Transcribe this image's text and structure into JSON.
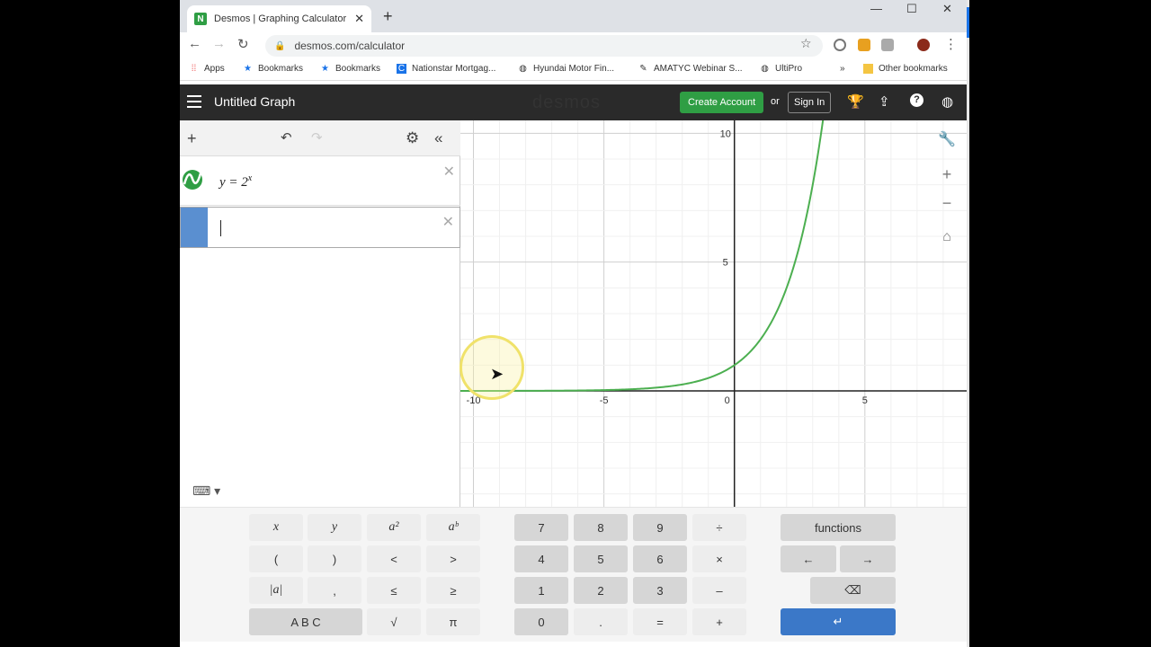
{
  "browser": {
    "tab_title": "Desmos | Graphing Calculator",
    "url": "desmos.com/calculator",
    "bookmarks": [
      "Apps",
      "Bookmarks",
      "Bookmarks",
      "Nationstar Mortgag...",
      "Hyundai Motor Fin...",
      "AMATYC Webinar S...",
      "UltiPro",
      "»",
      "Other bookmarks"
    ]
  },
  "header": {
    "title": "Untitled Graph",
    "logo": "desmos",
    "create_account": "Create Account",
    "or": "or",
    "sign_in": "Sign In"
  },
  "expressions": [
    {
      "latex_display": "y = 2",
      "superscript": "x",
      "color": "#2f9e44"
    },
    {
      "latex_display": "",
      "active": true
    }
  ],
  "graph": {
    "x_ticks": [
      "-10",
      "-5",
      "0",
      "5"
    ],
    "y_ticks": [
      "10",
      "5"
    ],
    "curve_color": "#4caf50",
    "function": "y = 2^x",
    "xlim": [
      -10.5,
      8.9
    ],
    "ylim": [
      -4.5,
      10.5
    ]
  },
  "keypad": {
    "left": [
      "x",
      "y",
      "a²",
      "aᵇ",
      "(",
      ")",
      "<",
      ">",
      "|a|",
      ",",
      "≤",
      "≥",
      "A B C",
      "√",
      "π"
    ],
    "num": [
      "7",
      "8",
      "9",
      "÷",
      "4",
      "5",
      "6",
      "×",
      "1",
      "2",
      "3",
      "–",
      "0",
      ".",
      "=",
      "+"
    ],
    "right": [
      "functions",
      "←",
      "→",
      "⌫",
      "↵"
    ]
  }
}
